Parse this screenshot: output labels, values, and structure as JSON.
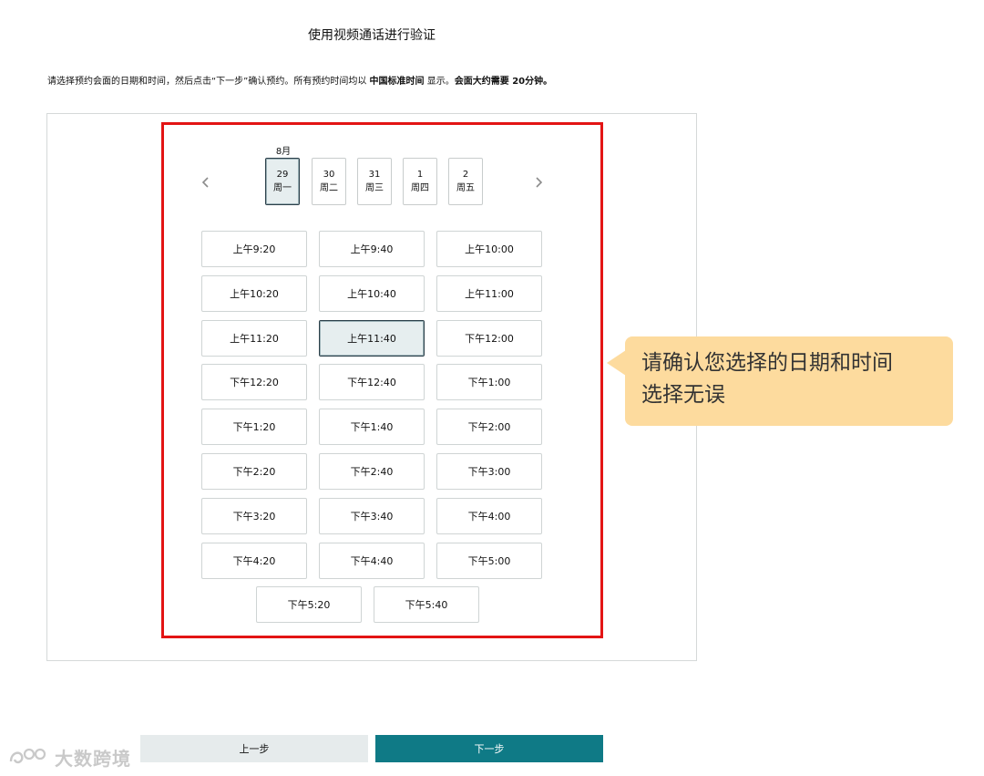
{
  "page": {
    "title": "使用视频通话进行验证",
    "instructions_part1": "请选择预约会面的日期和时间，然后点击“下一步”确认预约。所有预约时间均以 ",
    "instructions_timezone": "中国标准时间",
    "instructions_part2": " 显示。",
    "instructions_duration": "会面大约需要 20分钟。"
  },
  "calendar": {
    "month": "8月",
    "prev_icon": "chevron-left-icon",
    "next_icon": "chevron-right-icon",
    "dates": [
      {
        "day": "29",
        "weekday": "周一",
        "selected": true
      },
      {
        "day": "30",
        "weekday": "周二",
        "selected": false
      },
      {
        "day": "31",
        "weekday": "周三",
        "selected": false
      },
      {
        "day": "1",
        "weekday": "周四",
        "selected": false
      },
      {
        "day": "2",
        "weekday": "周五",
        "selected": false
      }
    ]
  },
  "time_slots": [
    "上午9:20",
    "上午9:40",
    "上午10:00",
    "上午10:20",
    "上午10:40",
    "上午11:00",
    "上午11:20",
    "上午11:40",
    "下午12:00",
    "下午12:20",
    "下午12:40",
    "下午1:00",
    "下午1:20",
    "下午1:40",
    "下午2:00",
    "下午2:20",
    "下午2:40",
    "下午3:00",
    "下午3:20",
    "下午3:40",
    "下午4:00",
    "下午4:20",
    "下午4:40",
    "下午5:00",
    "下午5:20",
    "下午5:40"
  ],
  "selected_slot": "上午11:40",
  "callout": {
    "line1": "请确认您选择的日期和时间",
    "line2": "选择无误"
  },
  "buttons": {
    "back": "上一步",
    "next": "下一步"
  },
  "watermark": {
    "text": "大数跨境",
    "icon": "logo-icon"
  },
  "colors": {
    "highlight": "#e31414",
    "primary": "#0f7a86",
    "callout_bg": "#fddb9e",
    "selected_bg": "#e6eeef"
  }
}
